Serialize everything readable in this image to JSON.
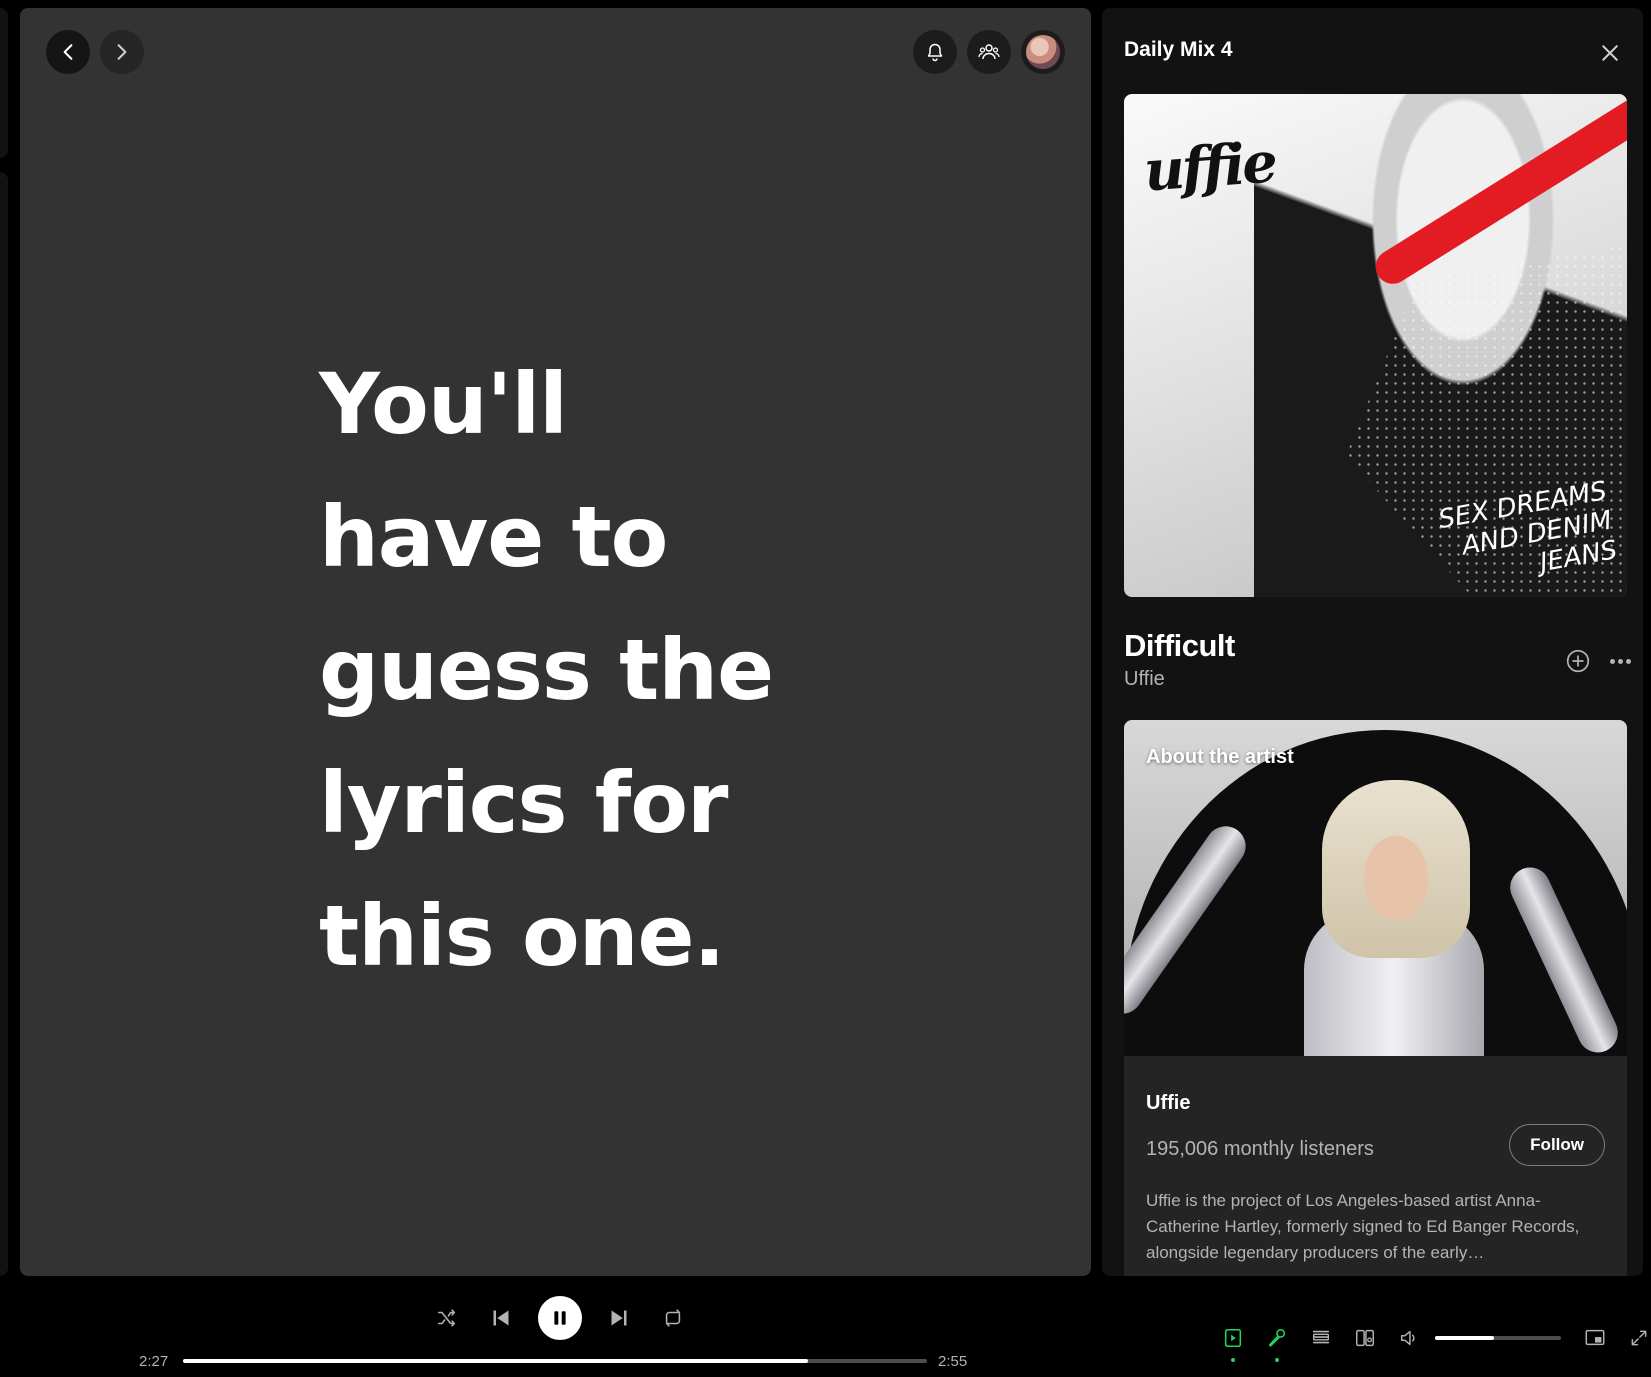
{
  "header": {
    "back_icon": "chevron-left-icon",
    "forward_icon": "chevron-right-icon",
    "notifications_icon": "bell-icon",
    "friends_icon": "friends-icon"
  },
  "lyrics": {
    "lines": [
      "You'll",
      "have to",
      "guess the",
      "lyrics for",
      "this one."
    ]
  },
  "sidebar": {
    "title": "Daily Mix 4",
    "album": {
      "logo_text": "uffie",
      "subtitle": "SEX DREAMS AND DENIM JEANS"
    },
    "track": {
      "title": "Difficult",
      "artist": "Uffie"
    },
    "about": {
      "label": "About the artist",
      "artist_name": "Uffie",
      "listeners": "195,006 monthly listeners",
      "follow_label": "Follow",
      "bio": "Uffie is the project of Los Angeles-based artist Anna-Catherine Hartley, formerly signed to Ed Banger Records, alongside legendary producers of the early…"
    }
  },
  "player": {
    "current_time": "2:27",
    "total_time": "2:55",
    "progress": 0.84,
    "volume": 0.47,
    "accent_color": "#1ed760"
  }
}
